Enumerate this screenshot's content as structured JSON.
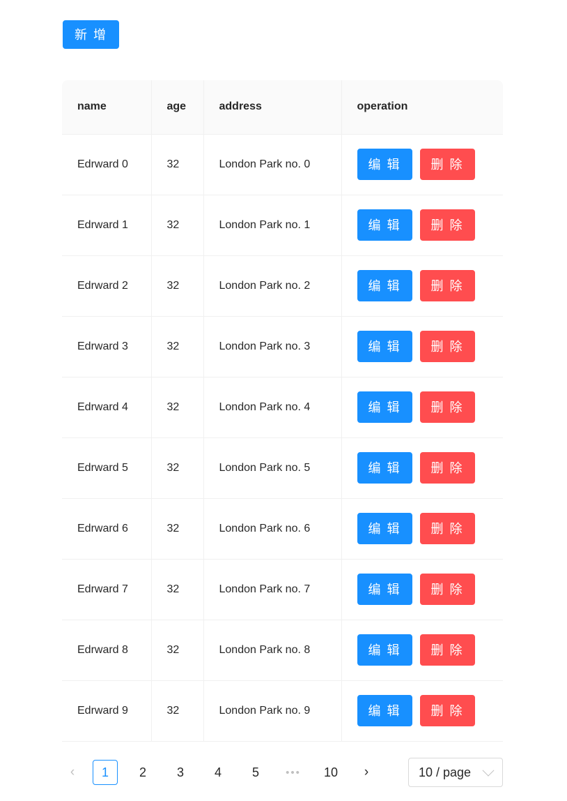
{
  "toolbar": {
    "add_label": "新 增"
  },
  "table": {
    "columns": [
      {
        "key": "name",
        "label": "name"
      },
      {
        "key": "age",
        "label": "age"
      },
      {
        "key": "address",
        "label": "address"
      },
      {
        "key": "operation",
        "label": "operation"
      }
    ],
    "row_actions": {
      "edit_label": "编 辑",
      "delete_label": "删 除"
    },
    "rows": [
      {
        "name": "Edrward 0",
        "age": "32",
        "address": "London Park no. 0"
      },
      {
        "name": "Edrward 1",
        "age": "32",
        "address": "London Park no. 1"
      },
      {
        "name": "Edrward 2",
        "age": "32",
        "address": "London Park no. 2"
      },
      {
        "name": "Edrward 3",
        "age": "32",
        "address": "London Park no. 3"
      },
      {
        "name": "Edrward 4",
        "age": "32",
        "address": "London Park no. 4"
      },
      {
        "name": "Edrward 5",
        "age": "32",
        "address": "London Park no. 5"
      },
      {
        "name": "Edrward 6",
        "age": "32",
        "address": "London Park no. 6"
      },
      {
        "name": "Edrward 7",
        "age": "32",
        "address": "London Park no. 7"
      },
      {
        "name": "Edrward 8",
        "age": "32",
        "address": "London Park no. 8"
      },
      {
        "name": "Edrward 9",
        "age": "32",
        "address": "London Park no. 9"
      }
    ]
  },
  "pagination": {
    "prev_icon": "chevron-left-icon",
    "prev_glyph": "‹",
    "prev_disabled": true,
    "next_icon": "chevron-right-icon",
    "next_glyph": "›",
    "next_disabled": false,
    "ellipsis_label": "•••",
    "current_page": "1",
    "pages": [
      "1",
      "2",
      "3",
      "4",
      "5"
    ],
    "last_page": "10",
    "page_size_label": "10 / page",
    "page_size_chevron_icon": "chevron-down-icon"
  },
  "colors": {
    "primary": "#1890ff",
    "danger": "#ff4d4f",
    "header_bg": "#fafafa",
    "border": "#f0f0f0",
    "disabled": "#bfbfbf"
  }
}
